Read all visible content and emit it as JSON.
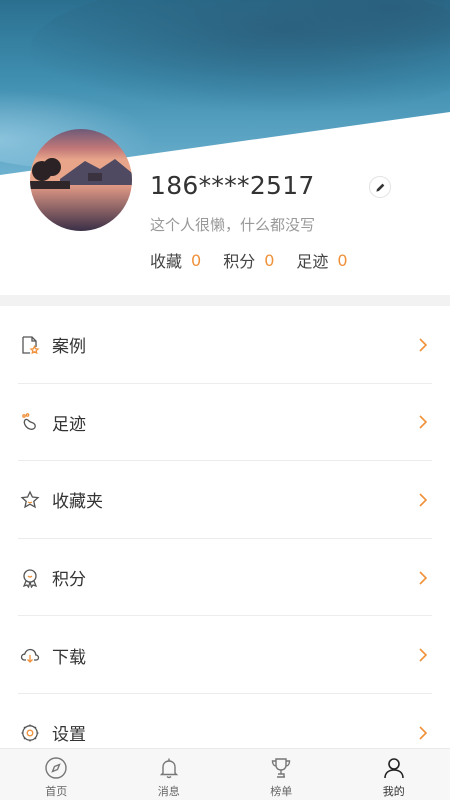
{
  "profile": {
    "phone": "186****2517",
    "bio": "这个人很懒，什么都没写",
    "stats": [
      {
        "label": "收藏",
        "value": "0"
      },
      {
        "label": "积分",
        "value": "0"
      },
      {
        "label": "足迹",
        "value": "0"
      }
    ]
  },
  "menu": [
    {
      "label": "案例",
      "icon": "case-file-icon"
    },
    {
      "label": "足迹",
      "icon": "footprint-icon"
    },
    {
      "label": "收藏夹",
      "icon": "star-icon"
    },
    {
      "label": "积分",
      "icon": "medal-icon"
    },
    {
      "label": "下载",
      "icon": "cloud-download-icon"
    },
    {
      "label": "设置",
      "icon": "gear-icon"
    }
  ],
  "tabs": [
    {
      "label": "首页",
      "icon": "compass-icon",
      "active": false
    },
    {
      "label": "消息",
      "icon": "bell-icon",
      "active": false
    },
    {
      "label": "榜单",
      "icon": "trophy-icon",
      "active": false
    },
    {
      "label": "我的",
      "icon": "user-icon",
      "active": true
    }
  ],
  "colors": {
    "accent": "#f0913a",
    "banner": "#3f8fb0",
    "divider": "#ececec"
  }
}
